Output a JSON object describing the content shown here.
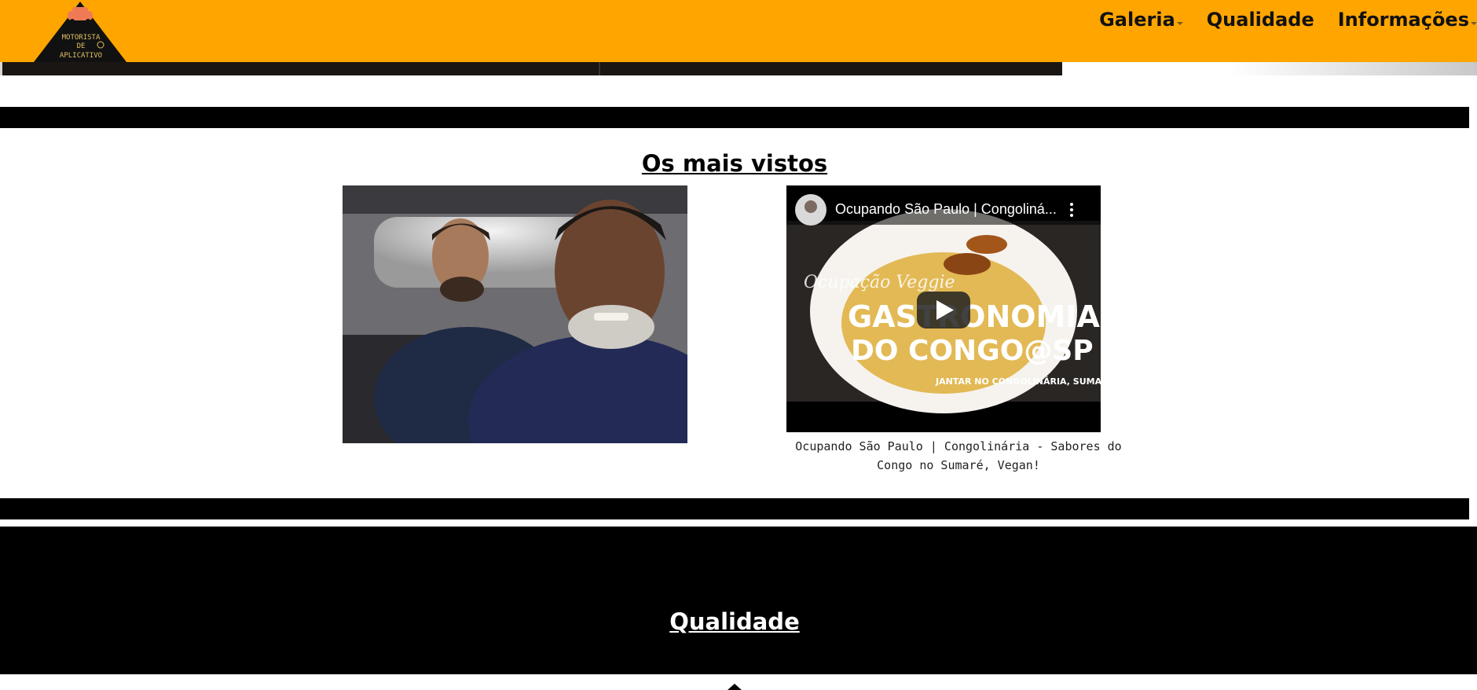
{
  "header": {
    "logo_alt": "Motorista de Aplicativo",
    "logo_lines": [
      "MOTORISTA",
      "DE",
      "APLICATIVO"
    ],
    "nav": [
      {
        "label": "Galeria",
        "has_dropdown": true
      },
      {
        "label": "Qualidade",
        "has_dropdown": false
      },
      {
        "label": "Informações",
        "has_dropdown": true
      }
    ],
    "accent_color": "#ffa500"
  },
  "most_viewed": {
    "title": "Os mais vistos",
    "photo_name": "selfie-in-car",
    "video": {
      "title": "Ocupando São Paulo | Congoliná...",
      "thumb_text_1": "Ocupação Veggie",
      "thumb_text_2": "GASTRONOMIA",
      "thumb_text_3": "DO CONGO@SP",
      "thumb_text_4": "JANTAR NO CONGOLINÁRIA, SUMARÉ",
      "caption": "Ocupando São Paulo | Congolinária - Sabores do Congo no Sumaré, Vegan!"
    }
  },
  "quality": {
    "title": "Qualidade"
  }
}
